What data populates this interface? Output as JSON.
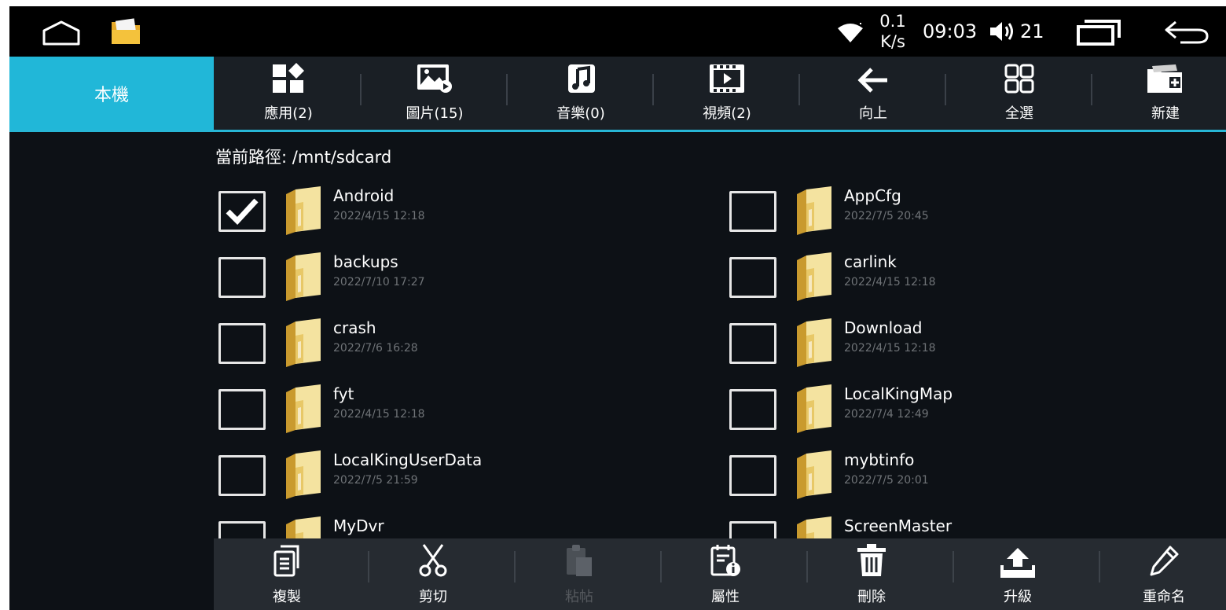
{
  "status_bar": {
    "net_speed_value": "0.1",
    "net_speed_unit": "K/s",
    "time": "09:03",
    "volume_level": "21",
    "icons": [
      "home-icon",
      "file-manager-icon",
      "wifi-icon",
      "volume-icon",
      "recents-icon",
      "back-icon"
    ]
  },
  "tabs": {
    "local_label": "本機"
  },
  "toolbar": {
    "items": [
      {
        "label": "應用(2)",
        "icon": "apps-icon"
      },
      {
        "label": "圖片(15)",
        "icon": "image-icon"
      },
      {
        "label": "音樂(0)",
        "icon": "music-icon"
      },
      {
        "label": "視頻(2)",
        "icon": "video-icon"
      },
      {
        "label": "向上",
        "icon": "arrow-up-level-icon"
      },
      {
        "label": "全選",
        "icon": "select-all-icon"
      },
      {
        "label": "新建",
        "icon": "new-folder-icon"
      }
    ]
  },
  "path_label": "當前路徑: /mnt/sdcard",
  "files": [
    {
      "name": "Android",
      "date": "2022/4/15 12:18",
      "checked": true
    },
    {
      "name": "AppCfg",
      "date": "2022/7/5 20:45",
      "checked": false
    },
    {
      "name": "backups",
      "date": "2022/7/10 17:27",
      "checked": false
    },
    {
      "name": "carlink",
      "date": "2022/4/15 12:18",
      "checked": false
    },
    {
      "name": "crash",
      "date": "2022/7/6 16:28",
      "checked": false
    },
    {
      "name": "Download",
      "date": "2022/4/15 12:18",
      "checked": false
    },
    {
      "name": "fyt",
      "date": "2022/4/15 12:18",
      "checked": false
    },
    {
      "name": "LocalKingMap",
      "date": "2022/7/4 12:49",
      "checked": false
    },
    {
      "name": "LocalKingUserData",
      "date": "2022/7/5 21:59",
      "checked": false
    },
    {
      "name": "mybtinfo",
      "date": "2022/7/5 20:01",
      "checked": false
    },
    {
      "name": "MyDvr",
      "date": "",
      "checked": false
    },
    {
      "name": "ScreenMaster",
      "date": "",
      "checked": false
    }
  ],
  "actions": {
    "items": [
      {
        "label": "複製",
        "icon": "copy-icon",
        "enabled": true
      },
      {
        "label": "剪切",
        "icon": "cut-icon",
        "enabled": true
      },
      {
        "label": "粘帖",
        "icon": "paste-icon",
        "enabled": false
      },
      {
        "label": "屬性",
        "icon": "properties-icon",
        "enabled": true
      },
      {
        "label": "刪除",
        "icon": "delete-icon",
        "enabled": true
      },
      {
        "label": "升級",
        "icon": "upgrade-icon",
        "enabled": true
      },
      {
        "label": "重命名",
        "icon": "rename-icon",
        "enabled": true
      }
    ]
  },
  "colors": {
    "accent": "#21b7d8",
    "background": "#0d1116",
    "status_bar": "#000000",
    "folder": "#f0d98a",
    "date_text": "#6f7377"
  }
}
